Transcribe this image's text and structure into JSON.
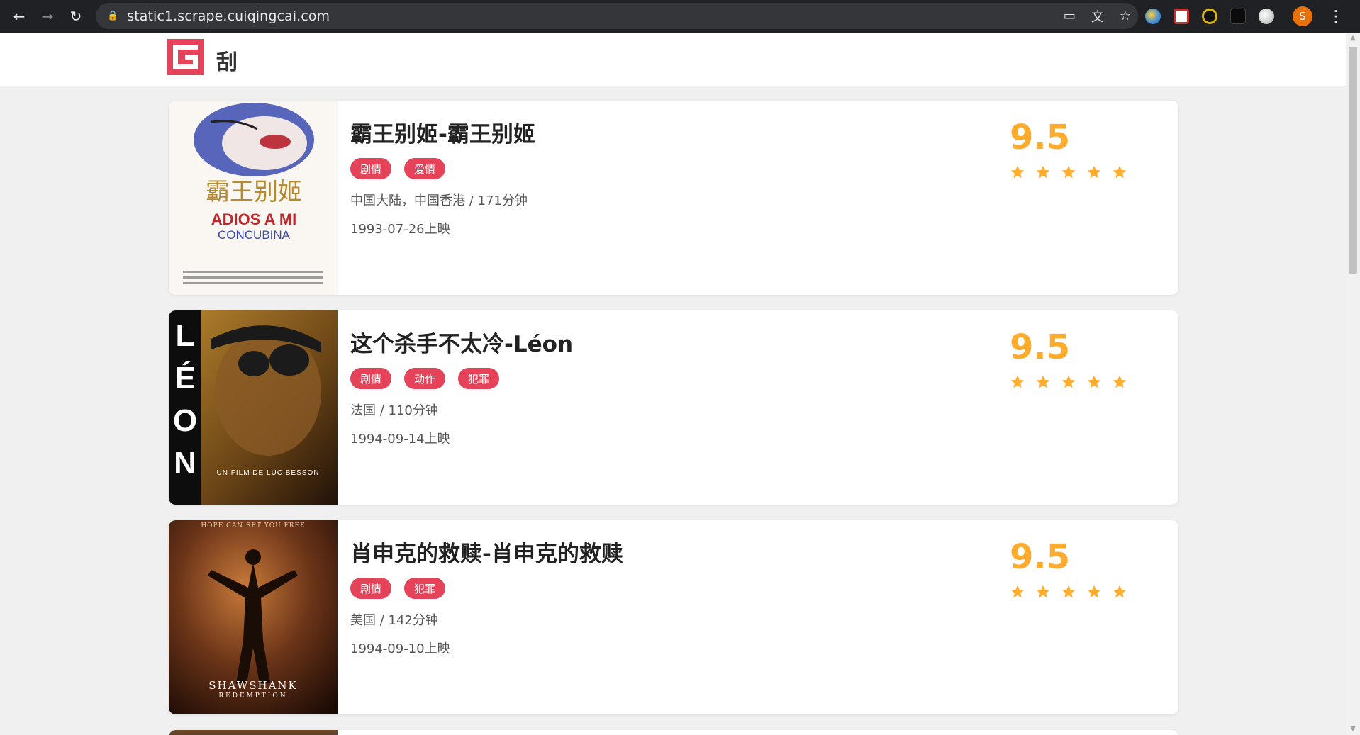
{
  "browser": {
    "url": "static1.scrape.cuiqingcai.com",
    "profile_initial": "S",
    "colors": {
      "chrome_bg": "#202124",
      "omnibox_bg": "#35363a",
      "profile": "#e8710a"
    }
  },
  "site": {
    "logo_text": "刮",
    "accent_color": "#e5435a",
    "score_color": "#ffac2d"
  },
  "movies": [
    {
      "title": "霸王别姬-霸王别姬",
      "tags": [
        "剧情",
        "爱情"
      ],
      "region_duration": "中国大陆，中国香港 / 171分钟",
      "release": "1993-07-26上映",
      "score": "9.5",
      "stars": 5,
      "poster_text": {
        "cn": "霸王别姬",
        "line1": "ADIOS A MI",
        "line2": "CONCUBINA"
      }
    },
    {
      "title": "这个杀手不太冷-Léon",
      "tags": [
        "剧情",
        "动作",
        "犯罪"
      ],
      "region_duration": "法国 / 110分钟",
      "release": "1994-09-14上映",
      "score": "9.5",
      "stars": 5,
      "poster_text": {
        "side": "LÉON",
        "line1": "UN FILM DE LUC BESSON"
      }
    },
    {
      "title": "肖申克的救赎-肖申克的救赎",
      "tags": [
        "剧情",
        "犯罪"
      ],
      "region_duration": "美国 / 142分钟",
      "release": "1994-09-10上映",
      "score": "9.5",
      "stars": 5,
      "poster_text": {
        "line1": "SHAWSHANK",
        "line2": "REDEMPTION",
        "top": "HOPE CAN SET YOU FREE"
      }
    }
  ]
}
